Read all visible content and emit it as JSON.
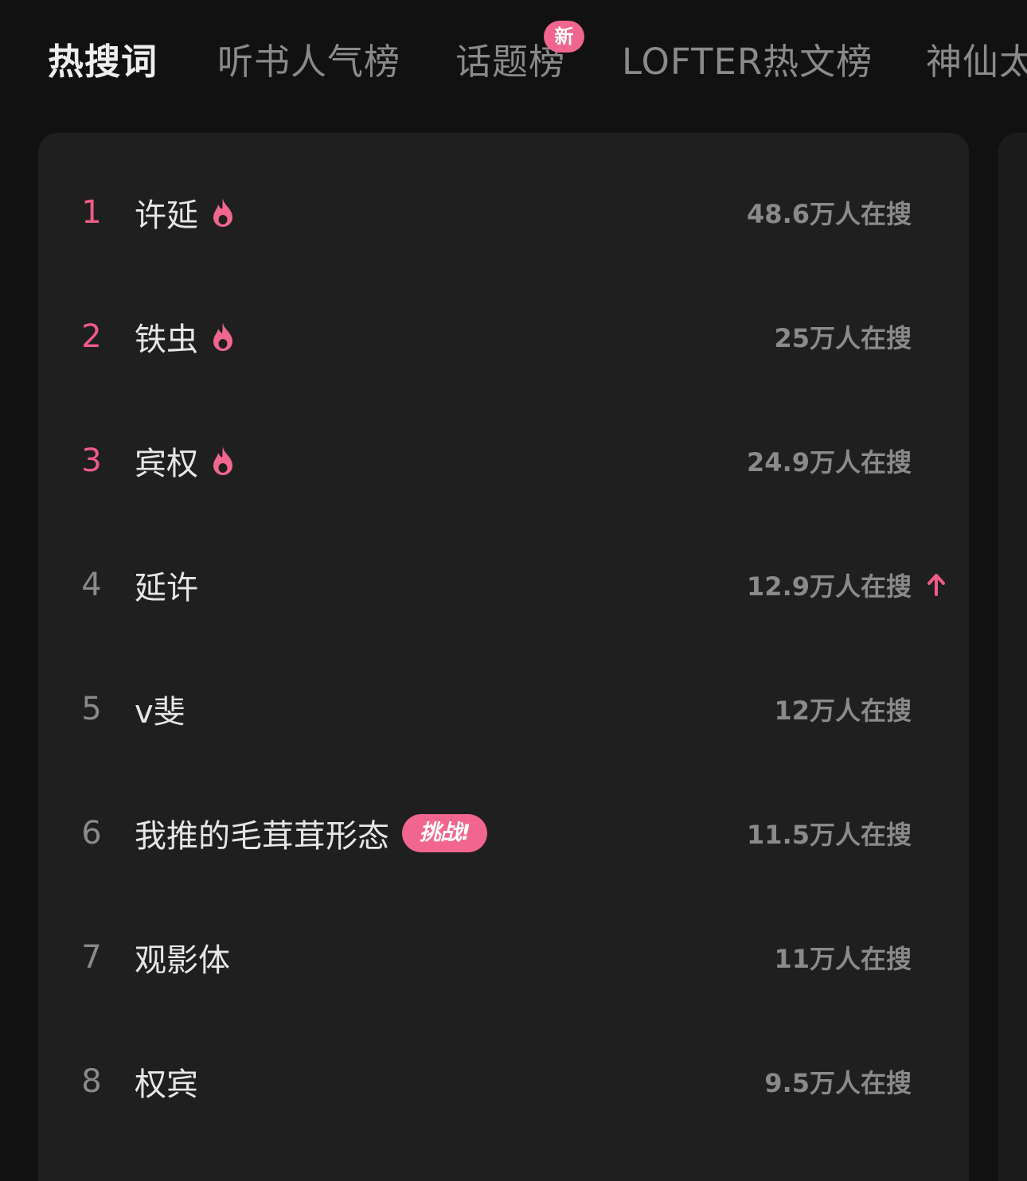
{
  "tabs": [
    {
      "label": "热搜词",
      "active": true
    },
    {
      "label": "听书人气榜",
      "active": false
    },
    {
      "label": "话题榜",
      "active": false,
      "badge": "新"
    },
    {
      "label": "LOFTER热文榜",
      "active": false
    },
    {
      "label": "神仙太",
      "active": false
    }
  ],
  "colors": {
    "background": "#111111",
    "card": "#1f1f1f",
    "accent": "#f0668f",
    "hot_rank": "#f05b88",
    "muted_text": "#8a8a8a"
  },
  "hot_list": [
    {
      "rank": "1",
      "word": "许延",
      "count": "48.6万人在搜",
      "icon": "fire-icon"
    },
    {
      "rank": "2",
      "word": "铁虫",
      "count": "25万人在搜",
      "icon": "fire-icon"
    },
    {
      "rank": "3",
      "word": "宾权",
      "count": "24.9万人在搜",
      "icon": "fire-icon"
    },
    {
      "rank": "4",
      "word": "延许",
      "count": "12.9万人在搜",
      "trend": "arrow-up-icon"
    },
    {
      "rank": "5",
      "word": "v斐",
      "count": "12万人在搜"
    },
    {
      "rank": "6",
      "word": "我推的毛茸茸形态",
      "count": "11.5万人在搜",
      "tag": "挑战!"
    },
    {
      "rank": "7",
      "word": "观影体",
      "count": "11万人在搜"
    },
    {
      "rank": "8",
      "word": "权宾",
      "count": "9.5万人在搜"
    }
  ]
}
